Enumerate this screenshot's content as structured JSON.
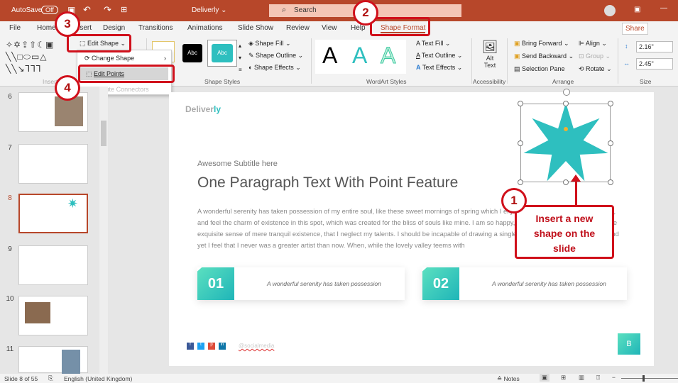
{
  "titlebar": {
    "autosave": "AutoSave",
    "autosave_state": "Off",
    "doc_title": "Deliverly ⌄",
    "search_placeholder": "Search"
  },
  "tabs": [
    "File",
    "Home",
    "Insert",
    "Design",
    "Transitions",
    "Animations",
    "Slide Show",
    "Review",
    "View",
    "Help",
    "Shape Format"
  ],
  "share": "Share",
  "ribbon": {
    "edit_shape": "Edit Shape ⌄",
    "change_shape": "Change Shape",
    "edit_points": "Edit Points",
    "reroute": "Reroute Connectors",
    "insert_shapes_group": "Insert Shapes",
    "style_abc": "Abc",
    "shape_fill": "Shape Fill ⌄",
    "shape_outline": "Shape Outline ⌄",
    "shape_effects": "Shape Effects ⌄",
    "shape_styles_group": "Shape Styles",
    "wordart_letter": "A",
    "text_fill": "Text Fill ⌄",
    "text_outline": "Text Outline ⌄",
    "text_effects": "Text Effects ⌄",
    "wordart_group": "WordArt Styles",
    "alt_text": "Alt Text",
    "accessibility_group": "Accessibility",
    "bring_forward": "Bring Forward ⌄",
    "send_backward": "Send Backward ⌄",
    "selection_pane": "Selection Pane",
    "align": "Align ⌄",
    "group": "Group ⌄",
    "rotate": "Rotate ⌄",
    "arrange_group": "Arrange",
    "height": "2.16\"",
    "width": "2.45\"",
    "size_group": "Size"
  },
  "thumbnails": [
    {
      "num": "6"
    },
    {
      "num": "7"
    },
    {
      "num": "8"
    },
    {
      "num": "9"
    },
    {
      "num": "10"
    },
    {
      "num": "11"
    }
  ],
  "slide": {
    "logo_a": "Deliver",
    "logo_b": "ly",
    "subtitle": "Awesome Subtitle here",
    "title": "One Paragraph Text With Point Feature",
    "paragraph": "A wonderful serenity has taken possession of my entire soul, like these sweet mornings of spring which I enjoy with my whole heart. I am alone, and feel the charm of existence in this spot, which was created for the bliss of souls like mine. I am so happy, my dear friend, so absorbed in the exquisite sense of mere tranquil existence, that I neglect my talents. I should be incapable of drawing a single stroke at the present moment; and yet I feel that I never was a greater artist than now. When, while the lovely valley teems with",
    "cards": [
      {
        "num": "01",
        "text": "A wonderful serenity has taken possession"
      },
      {
        "num": "02",
        "text": "A wonderful serenity has taken possession"
      }
    ],
    "social": [
      "f",
      "t",
      "p",
      "in"
    ],
    "social_handle": "@socialmedia",
    "badge": "B"
  },
  "callouts": {
    "step1": "1",
    "step2": "2",
    "step3": "3",
    "step4": "4",
    "note": "Insert a new shape on the slide"
  },
  "status": {
    "slide": "Slide 8 of 55",
    "language": "English (United Kingdom)",
    "notes": "Notes"
  },
  "colors": {
    "accent": "#b7472a",
    "teal": "#2ebfbf",
    "callout": "#d0101b"
  }
}
